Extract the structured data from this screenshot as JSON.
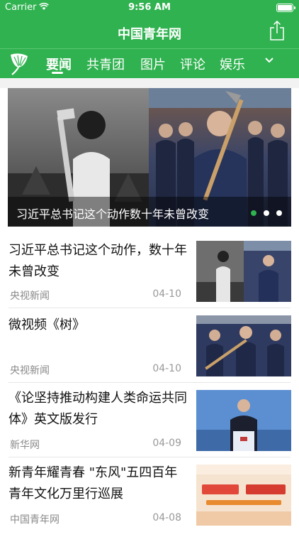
{
  "status_bar": {
    "carrier": "Carrier",
    "time": "9:56 AM"
  },
  "app": {
    "title": "中国青年网"
  },
  "tabs": [
    {
      "label": "要闻",
      "active": true
    },
    {
      "label": "共青团"
    },
    {
      "label": "图片"
    },
    {
      "label": "评论"
    },
    {
      "label": "娱乐"
    }
  ],
  "carousel": {
    "caption": "习近平总书记这个动作数十年未曾改变",
    "dots": 3,
    "active_dot": 0
  },
  "articles": [
    {
      "title": "习近平总书记这个动作，数十年未曾改变",
      "source": "央视新闻",
      "date": "04-10"
    },
    {
      "title": "微视频《树》",
      "source": "央视新闻",
      "date": "04-10"
    },
    {
      "title": "《论坚持推动构建人类命运共同体》英文版发行",
      "source": "新华网",
      "date": "04-09"
    },
    {
      "title": "新青年耀青春 \"东风\"五四百年青年文化万里行巡展",
      "source": "中国青年网",
      "date": "04-08"
    }
  ],
  "colors": {
    "brand": "#2fb24f",
    "text": "#111111",
    "meta": "#888888"
  }
}
